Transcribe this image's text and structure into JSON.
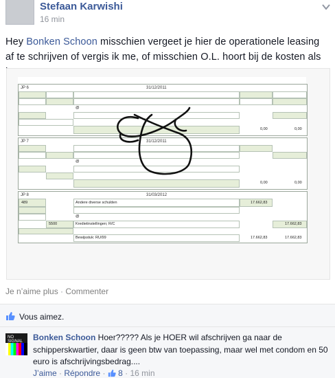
{
  "post": {
    "author": "Stefaan Karwishi",
    "time": "16 min",
    "text_before": "Hey ",
    "mention": "Bonken Schoon",
    "text_after": " misschien vergeet je hier de operationele leasing af te schrijven of vergis ik me, of misschien O.L. hoort bij de kosten als hoer."
  },
  "spreadsheet": {
    "jp6": {
      "label": "JP 6",
      "date": "31/12/2011",
      "at": "@",
      "total_debit": "0,00",
      "total_credit": "0,00"
    },
    "jp7": {
      "label": "JP 7",
      "date": "31/12/2011",
      "at": "@",
      "total_debit": "0,00",
      "total_credit": "0,00"
    },
    "jp8": {
      "label": "JP 8",
      "date": "31/03/2012",
      "row1_account": "489",
      "row1_desc": "Andere diverse schulden",
      "row1_amount": "17.662,83",
      "at": "@",
      "row2_account": "5500",
      "row2_desc": "Kredietinstellingen; R/C",
      "row2_amount": "17.662,83",
      "footer": "Bewijsstuk: RU/99",
      "total_debit": "17.662,83",
      "total_credit": "17.662,83"
    }
  },
  "actions": {
    "unlike": "Je n’aime plus",
    "sep": " · ",
    "comment": "Commenter"
  },
  "likes": {
    "text": "Vous aimez."
  },
  "comment": {
    "avatar_tag": "NO SIGNAL",
    "author": "Bonken Schoon",
    "text": " Hoer????? Als je HOER wil afschrijven ga naar de schipperskwartier, daar is geen btw van toepassing, maar wel met condom en 50 euro is afschrijvingsbedrag....",
    "like": "J’aime",
    "reply": "Répondre",
    "like_count": "8",
    "time": "16 min"
  },
  "colors": {
    "link": "#3b5998",
    "muted": "#90949c",
    "sheet_fill": "#e6eed9"
  }
}
